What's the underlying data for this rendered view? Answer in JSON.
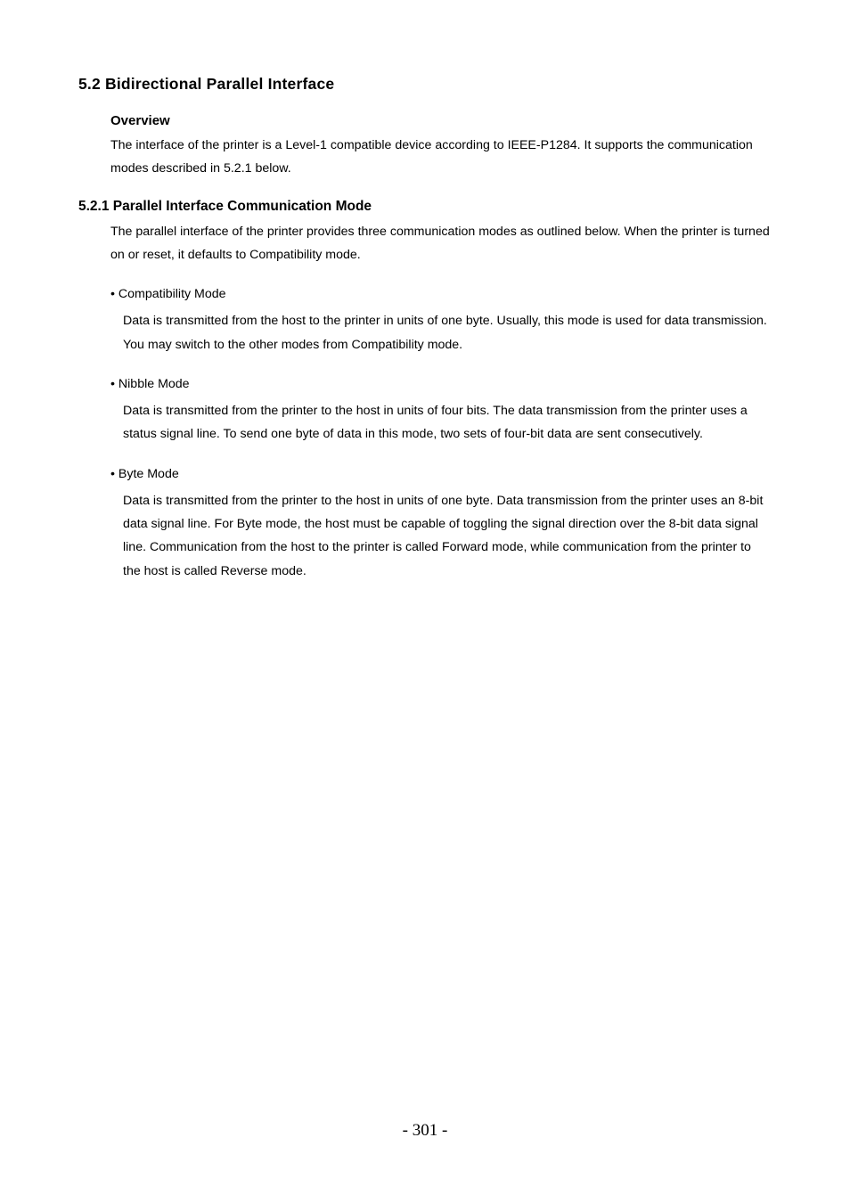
{
  "section_heading": "5.2 Bidirectional Parallel Interface",
  "overview": {
    "heading": "Overview",
    "paragraph": "The interface of the printer is a Level-1 compatible device according to IEEE-P1284. It supports the communication modes described in 5.2.1 below."
  },
  "subsection": {
    "heading": "5.2.1 Parallel Interface Communication Mode",
    "paragraph": "The parallel interface of the printer provides three communication modes as outlined below. When the printer is turned on or reset, it defaults to Compatibility mode."
  },
  "bullets": [
    {
      "title": "• Compatibility Mode",
      "body": "Data is transmitted from the host to the printer in units of one byte. Usually, this mode is used for data transmission. You may switch to the other modes from Compatibility mode."
    },
    {
      "title": "• Nibble Mode",
      "body": "Data is transmitted from the printer to the host in units of four bits. The data transmission from the printer uses a status signal line. To send one byte of data in this mode, two sets of four-bit data are sent consecutively."
    },
    {
      "title": "• Byte Mode",
      "body": "Data is transmitted from the printer to the host in units of one byte. Data transmission from the printer uses an 8-bit data signal line. For Byte mode, the host must be capable of toggling the signal direction over the 8-bit data signal line. Communication from the host to the printer is called Forward mode, while communication from the printer to the host is called Reverse mode."
    }
  ],
  "page_number": "- 301 -"
}
